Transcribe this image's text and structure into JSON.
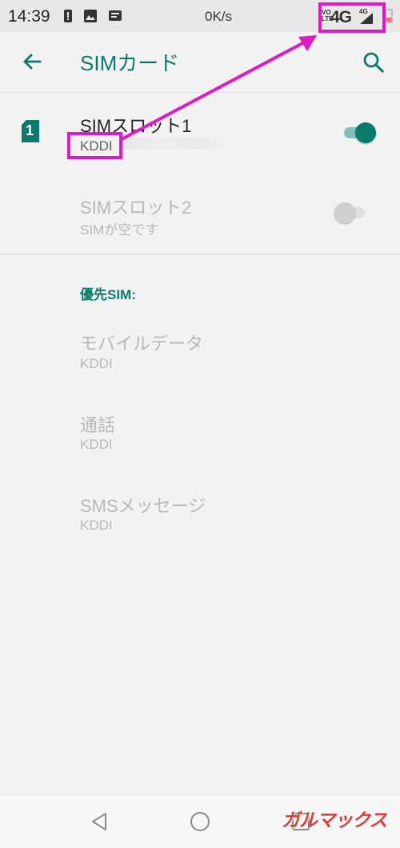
{
  "status_bar": {
    "time": "14:39",
    "speed": "0K/s",
    "volte": "VoLTE",
    "network": "4G",
    "network_small": "4G",
    "icons": [
      "alert-icon",
      "image-icon",
      "message-icon",
      "signal-icon",
      "battery-icon"
    ]
  },
  "app_bar": {
    "title": "SIMカード",
    "back_icon": "arrow-back-icon",
    "search_icon": "search-icon"
  },
  "sim_slots": [
    {
      "title": "SIMスロット1",
      "subtitle": "KDDI",
      "badge": "1",
      "enabled": true
    },
    {
      "title": "SIMスロット2",
      "subtitle": "SIMが空です",
      "enabled": false
    }
  ],
  "preferred": {
    "header": "優先SIM:",
    "items": [
      {
        "title": "モバイルデータ",
        "subtitle": "KDDI"
      },
      {
        "title": "通話",
        "subtitle": "KDDI"
      },
      {
        "title": "SMSメッセージ",
        "subtitle": "KDDI"
      }
    ]
  },
  "nav_bar": {
    "icons": [
      "back-triangle-icon",
      "home-circle-icon",
      "recents-square-icon"
    ]
  },
  "watermark": "ガルマックス",
  "colors": {
    "accent": "#0b7a6b",
    "annotation": "#e019c6",
    "toggle_on_thumb": "#0b7a6b",
    "toggle_on_track": "#7fc2b8",
    "toggle_off_thumb": "#cfcfcf",
    "toggle_off_track": "#e0e0e0"
  }
}
